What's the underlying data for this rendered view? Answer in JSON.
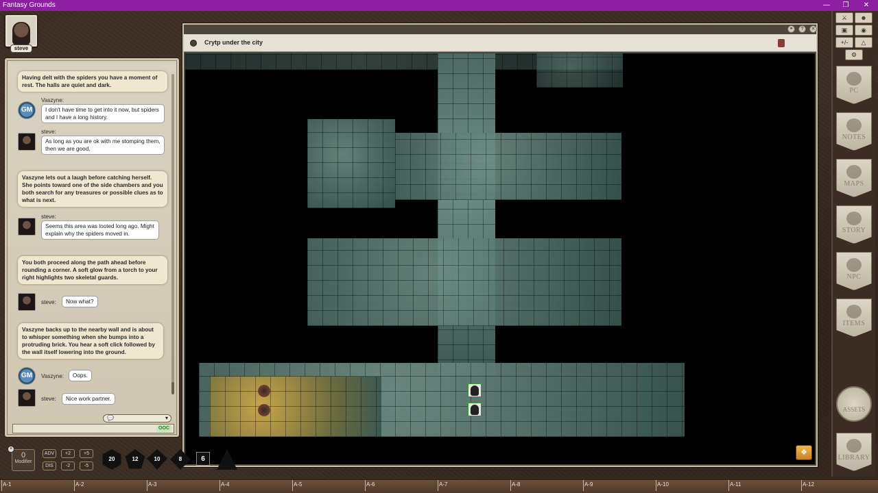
{
  "window": {
    "title": "Fantasy Grounds"
  },
  "identity": {
    "name": "steve"
  },
  "chat": {
    "messages": [
      {
        "type": "story",
        "text": "Having delt with the spiders you have a moment of rest. The halls are quiet and dark."
      },
      {
        "type": "speech",
        "speaker": "Vaszyne:",
        "avatar": "gm",
        "text": "I don't have time to get into it now, but spiders and I have a long history."
      },
      {
        "type": "speech",
        "speaker": "steve:",
        "avatar": "face",
        "text": "As long as you are ok with me stomping them, then we are good."
      },
      {
        "type": "story",
        "text": "Vaszyne lets out a laugh before catching herself. She points toward one of the side chambers and you both search for any treasures or possible clues as to what is next."
      },
      {
        "type": "speech",
        "speaker": "steve:",
        "avatar": "face",
        "text": "Seems this area was looted long ago. Might explain why the spiders moved in."
      },
      {
        "type": "story",
        "text": "You both proceed along the path ahead before rounding a corner. A soft glow from a torch to your right highlights two skeletal guards."
      },
      {
        "type": "inline",
        "speaker": "steve:",
        "avatar": "face",
        "text": "Now what?"
      },
      {
        "type": "story",
        "text": "Vaszyne backs up to the nearby wall and is about to whisper something when she bumps into a protruding brick. You hear a soft click followed by the wall itself lowering into the ground."
      },
      {
        "type": "inline",
        "speaker": "Vaszyne:",
        "avatar": "gm",
        "text": "Oops."
      },
      {
        "type": "inline",
        "speaker": "steve:",
        "avatar": "face",
        "text": "Nice work partner."
      }
    ],
    "gm_badge": "GM",
    "ooc_label": "OOC",
    "entry_value": ""
  },
  "map": {
    "title": "Crytp under the city"
  },
  "sidebar": {
    "tabs": [
      "PC",
      "NOTES",
      "MAPS",
      "STORY",
      "NPC",
      "ITEMS"
    ],
    "assets_label": "ASSETS",
    "library_label": "LIBRARY",
    "tool_row_3": "+/-"
  },
  "hotbar": {
    "modifier_value": "0",
    "modifier_caption": "Modifier",
    "buttons": [
      "ADV",
      "+2",
      "+5",
      "DIS",
      "-2",
      "-5"
    ],
    "dice": [
      "20",
      "12",
      "10",
      "8",
      "6"
    ]
  },
  "ruler": [
    "A-1",
    "A-2",
    "A-3",
    "A-4",
    "A-5",
    "A-6",
    "A-7",
    "A-8",
    "A-9",
    "A-10",
    "A-11",
    "A-12"
  ]
}
